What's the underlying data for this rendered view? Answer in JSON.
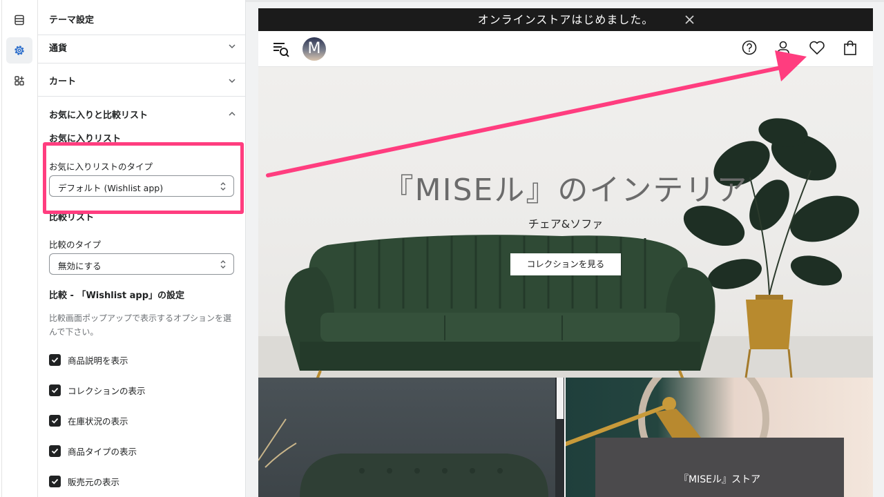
{
  "panel": {
    "title": "テーマ設定",
    "sections": {
      "currency": "通貨",
      "cart": "カート",
      "wishlist_compare": "お気に入りと比較リスト"
    },
    "wishlist": {
      "heading": "お気に入りリスト",
      "type_label": "お気に入りリストのタイプ",
      "type_value": "デフォルト (Wishlist app)"
    },
    "compare": {
      "heading": "比較リスト",
      "type_label": "比較のタイプ",
      "type_value": "無効にする",
      "settings_heading": "比較 - 「Wishlist app」の設定",
      "description": "比較画面ポップアップで表示するオプションを選んで下さい。",
      "options": [
        {
          "label": "商品説明を表示",
          "checked": true
        },
        {
          "label": "コレクションの表示",
          "checked": true
        },
        {
          "label": "在庫状況の表示",
          "checked": true
        },
        {
          "label": "商品タイプの表示",
          "checked": true
        },
        {
          "label": "販売元の表示",
          "checked": true
        }
      ]
    }
  },
  "preview": {
    "announcement": "オンラインストアはじめました。",
    "logo_letter": "M",
    "hero": {
      "title": "『MISEル』のインテリア",
      "subtitle": "チェア&ソファ",
      "button": "コレクションを見る"
    },
    "tile_right_caption": "『MISEル』ストア"
  },
  "colors": {
    "highlight": "#ff3d7f",
    "announcement_bg": "#1b1b1b",
    "sofa": "#2f4a35"
  },
  "icons": [
    "layout-icon",
    "gear-icon",
    "apps-icon",
    "chevron-down-icon",
    "chevron-up-icon",
    "select-arrows-icon",
    "checkbox-icon",
    "close-icon",
    "menu-search-icon",
    "help-icon",
    "account-icon",
    "heart-icon",
    "bag-icon"
  ]
}
